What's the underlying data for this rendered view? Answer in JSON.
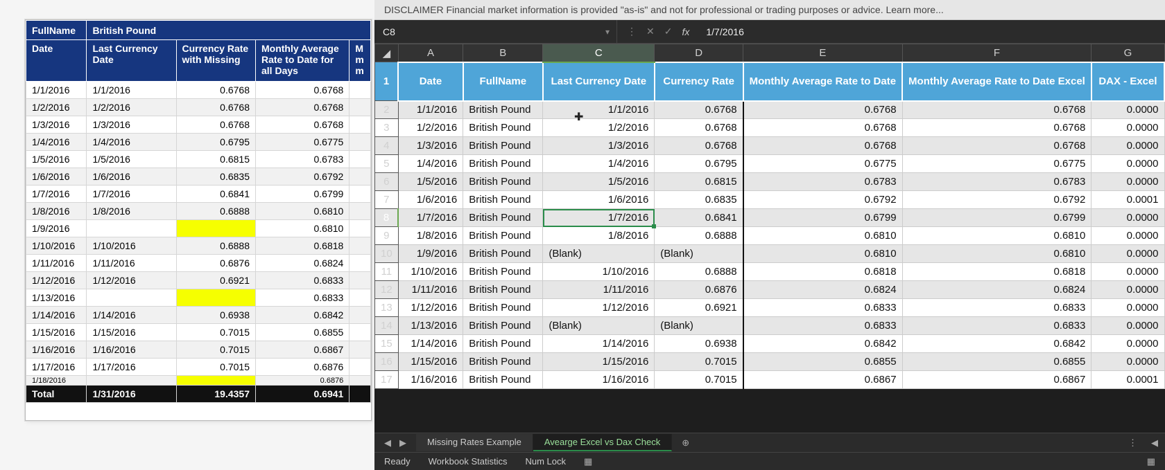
{
  "disclaimer": "DISCLAIMER   Financial market information is provided \"as-is\" and not for professional or trading purposes or advice. Learn more...",
  "nameBox": "C8",
  "formula": "1/7/2016",
  "columns": [
    "A",
    "B",
    "C",
    "D",
    "E",
    "F",
    "G"
  ],
  "dataHeaders": [
    "Date",
    "FullName",
    "Last Currency Date",
    "Currency Rate",
    "Monthly Average Rate to Date",
    "Monthly Average Rate to Date Excel",
    "DAX - Excel"
  ],
  "rows": [
    {
      "n": 2,
      "date": "1/1/2016",
      "name": "British Pound",
      "lcd": "1/1/2016",
      "rate": "0.6768",
      "m1": "0.6768",
      "m2": "0.6768",
      "dx": "0.0000"
    },
    {
      "n": 3,
      "date": "1/2/2016",
      "name": "British Pound",
      "lcd": "1/2/2016",
      "rate": "0.6768",
      "m1": "0.6768",
      "m2": "0.6768",
      "dx": "0.0000"
    },
    {
      "n": 4,
      "date": "1/3/2016",
      "name": "British Pound",
      "lcd": "1/3/2016",
      "rate": "0.6768",
      "m1": "0.6768",
      "m2": "0.6768",
      "dx": "0.0000"
    },
    {
      "n": 5,
      "date": "1/4/2016",
      "name": "British Pound",
      "lcd": "1/4/2016",
      "rate": "0.6795",
      "m1": "0.6775",
      "m2": "0.6775",
      "dx": "0.0000"
    },
    {
      "n": 6,
      "date": "1/5/2016",
      "name": "British Pound",
      "lcd": "1/5/2016",
      "rate": "0.6815",
      "m1": "0.6783",
      "m2": "0.6783",
      "dx": "0.0000"
    },
    {
      "n": 7,
      "date": "1/6/2016",
      "name": "British Pound",
      "lcd": "1/6/2016",
      "rate": "0.6835",
      "m1": "0.6792",
      "m2": "0.6792",
      "dx": "0.0001"
    },
    {
      "n": 8,
      "date": "1/7/2016",
      "name": "British Pound",
      "lcd": "1/7/2016",
      "rate": "0.6841",
      "m1": "0.6799",
      "m2": "0.6799",
      "dx": "0.0000",
      "sel": true
    },
    {
      "n": 9,
      "date": "1/8/2016",
      "name": "British Pound",
      "lcd": "1/8/2016",
      "rate": "0.6888",
      "m1": "0.6810",
      "m2": "0.6810",
      "dx": "0.0000"
    },
    {
      "n": 10,
      "date": "1/9/2016",
      "name": "British Pound",
      "lcd": "(Blank)",
      "rate": "(Blank)",
      "m1": "0.6810",
      "m2": "0.6810",
      "dx": "0.0000",
      "blank": true
    },
    {
      "n": 11,
      "date": "1/10/2016",
      "name": "British Pound",
      "lcd": "1/10/2016",
      "rate": "0.6888",
      "m1": "0.6818",
      "m2": "0.6818",
      "dx": "0.0000"
    },
    {
      "n": 12,
      "date": "1/11/2016",
      "name": "British Pound",
      "lcd": "1/11/2016",
      "rate": "0.6876",
      "m1": "0.6824",
      "m2": "0.6824",
      "dx": "0.0000"
    },
    {
      "n": 13,
      "date": "1/12/2016",
      "name": "British Pound",
      "lcd": "1/12/2016",
      "rate": "0.6921",
      "m1": "0.6833",
      "m2": "0.6833",
      "dx": "0.0000"
    },
    {
      "n": 14,
      "date": "1/13/2016",
      "name": "British Pound",
      "lcd": "(Blank)",
      "rate": "(Blank)",
      "m1": "0.6833",
      "m2": "0.6833",
      "dx": "0.0000",
      "blank": true
    },
    {
      "n": 15,
      "date": "1/14/2016",
      "name": "British Pound",
      "lcd": "1/14/2016",
      "rate": "0.6938",
      "m1": "0.6842",
      "m2": "0.6842",
      "dx": "0.0000"
    },
    {
      "n": 16,
      "date": "1/15/2016",
      "name": "British Pound",
      "lcd": "1/15/2016",
      "rate": "0.7015",
      "m1": "0.6855",
      "m2": "0.6855",
      "dx": "0.0000"
    },
    {
      "n": 17,
      "date": "1/16/2016",
      "name": "British Pound",
      "lcd": "1/16/2016",
      "rate": "0.7015",
      "m1": "0.6867",
      "m2": "0.6867",
      "dx": "0.0001"
    }
  ],
  "sheets": {
    "tabs": [
      "Missing Rates Example",
      "Avearge Excel vs Dax Check"
    ],
    "active": 1
  },
  "status": [
    "Ready",
    "Workbook Statistics",
    "Num Lock"
  ],
  "left": {
    "title": {
      "c1": "FullName",
      "c2": "British Pound"
    },
    "headers": [
      "Date",
      "Last Currency Date",
      "Currency Rate with Missing",
      "Monthly Average Rate to Date for all Days",
      "M m m"
    ],
    "rows": [
      {
        "d": "1/1/2016",
        "lcd": "1/1/2016",
        "r": "0.6768",
        "m": "0.6768"
      },
      {
        "d": "1/2/2016",
        "lcd": "1/2/2016",
        "r": "0.6768",
        "m": "0.6768"
      },
      {
        "d": "1/3/2016",
        "lcd": "1/3/2016",
        "r": "0.6768",
        "m": "0.6768"
      },
      {
        "d": "1/4/2016",
        "lcd": "1/4/2016",
        "r": "0.6795",
        "m": "0.6775"
      },
      {
        "d": "1/5/2016",
        "lcd": "1/5/2016",
        "r": "0.6815",
        "m": "0.6783"
      },
      {
        "d": "1/6/2016",
        "lcd": "1/6/2016",
        "r": "0.6835",
        "m": "0.6792"
      },
      {
        "d": "1/7/2016",
        "lcd": "1/7/2016",
        "r": "0.6841",
        "m": "0.6799"
      },
      {
        "d": "1/8/2016",
        "lcd": "1/8/2016",
        "r": "0.6888",
        "m": "0.6810"
      },
      {
        "d": "1/9/2016",
        "lcd": "",
        "r": "",
        "m": "0.6810",
        "yellow": true
      },
      {
        "d": "1/10/2016",
        "lcd": "1/10/2016",
        "r": "0.6888",
        "m": "0.6818"
      },
      {
        "d": "1/11/2016",
        "lcd": "1/11/2016",
        "r": "0.6876",
        "m": "0.6824"
      },
      {
        "d": "1/12/2016",
        "lcd": "1/12/2016",
        "r": "0.6921",
        "m": "0.6833"
      },
      {
        "d": "1/13/2016",
        "lcd": "",
        "r": "",
        "m": "0.6833",
        "yellow": true
      },
      {
        "d": "1/14/2016",
        "lcd": "1/14/2016",
        "r": "0.6938",
        "m": "0.6842"
      },
      {
        "d": "1/15/2016",
        "lcd": "1/15/2016",
        "r": "0.7015",
        "m": "0.6855"
      },
      {
        "d": "1/16/2016",
        "lcd": "1/16/2016",
        "r": "0.7015",
        "m": "0.6867"
      },
      {
        "d": "1/17/2016",
        "lcd": "1/17/2016",
        "r": "0.7015",
        "m": "0.6876"
      },
      {
        "d": "1/18/2016",
        "lcd": "",
        "r": "",
        "m": "0.6876",
        "yellow": true,
        "tiny": true
      }
    ],
    "total": {
      "label": "Total",
      "lcd": "1/31/2016",
      "r": "19.4357",
      "m": "0.6941"
    }
  }
}
